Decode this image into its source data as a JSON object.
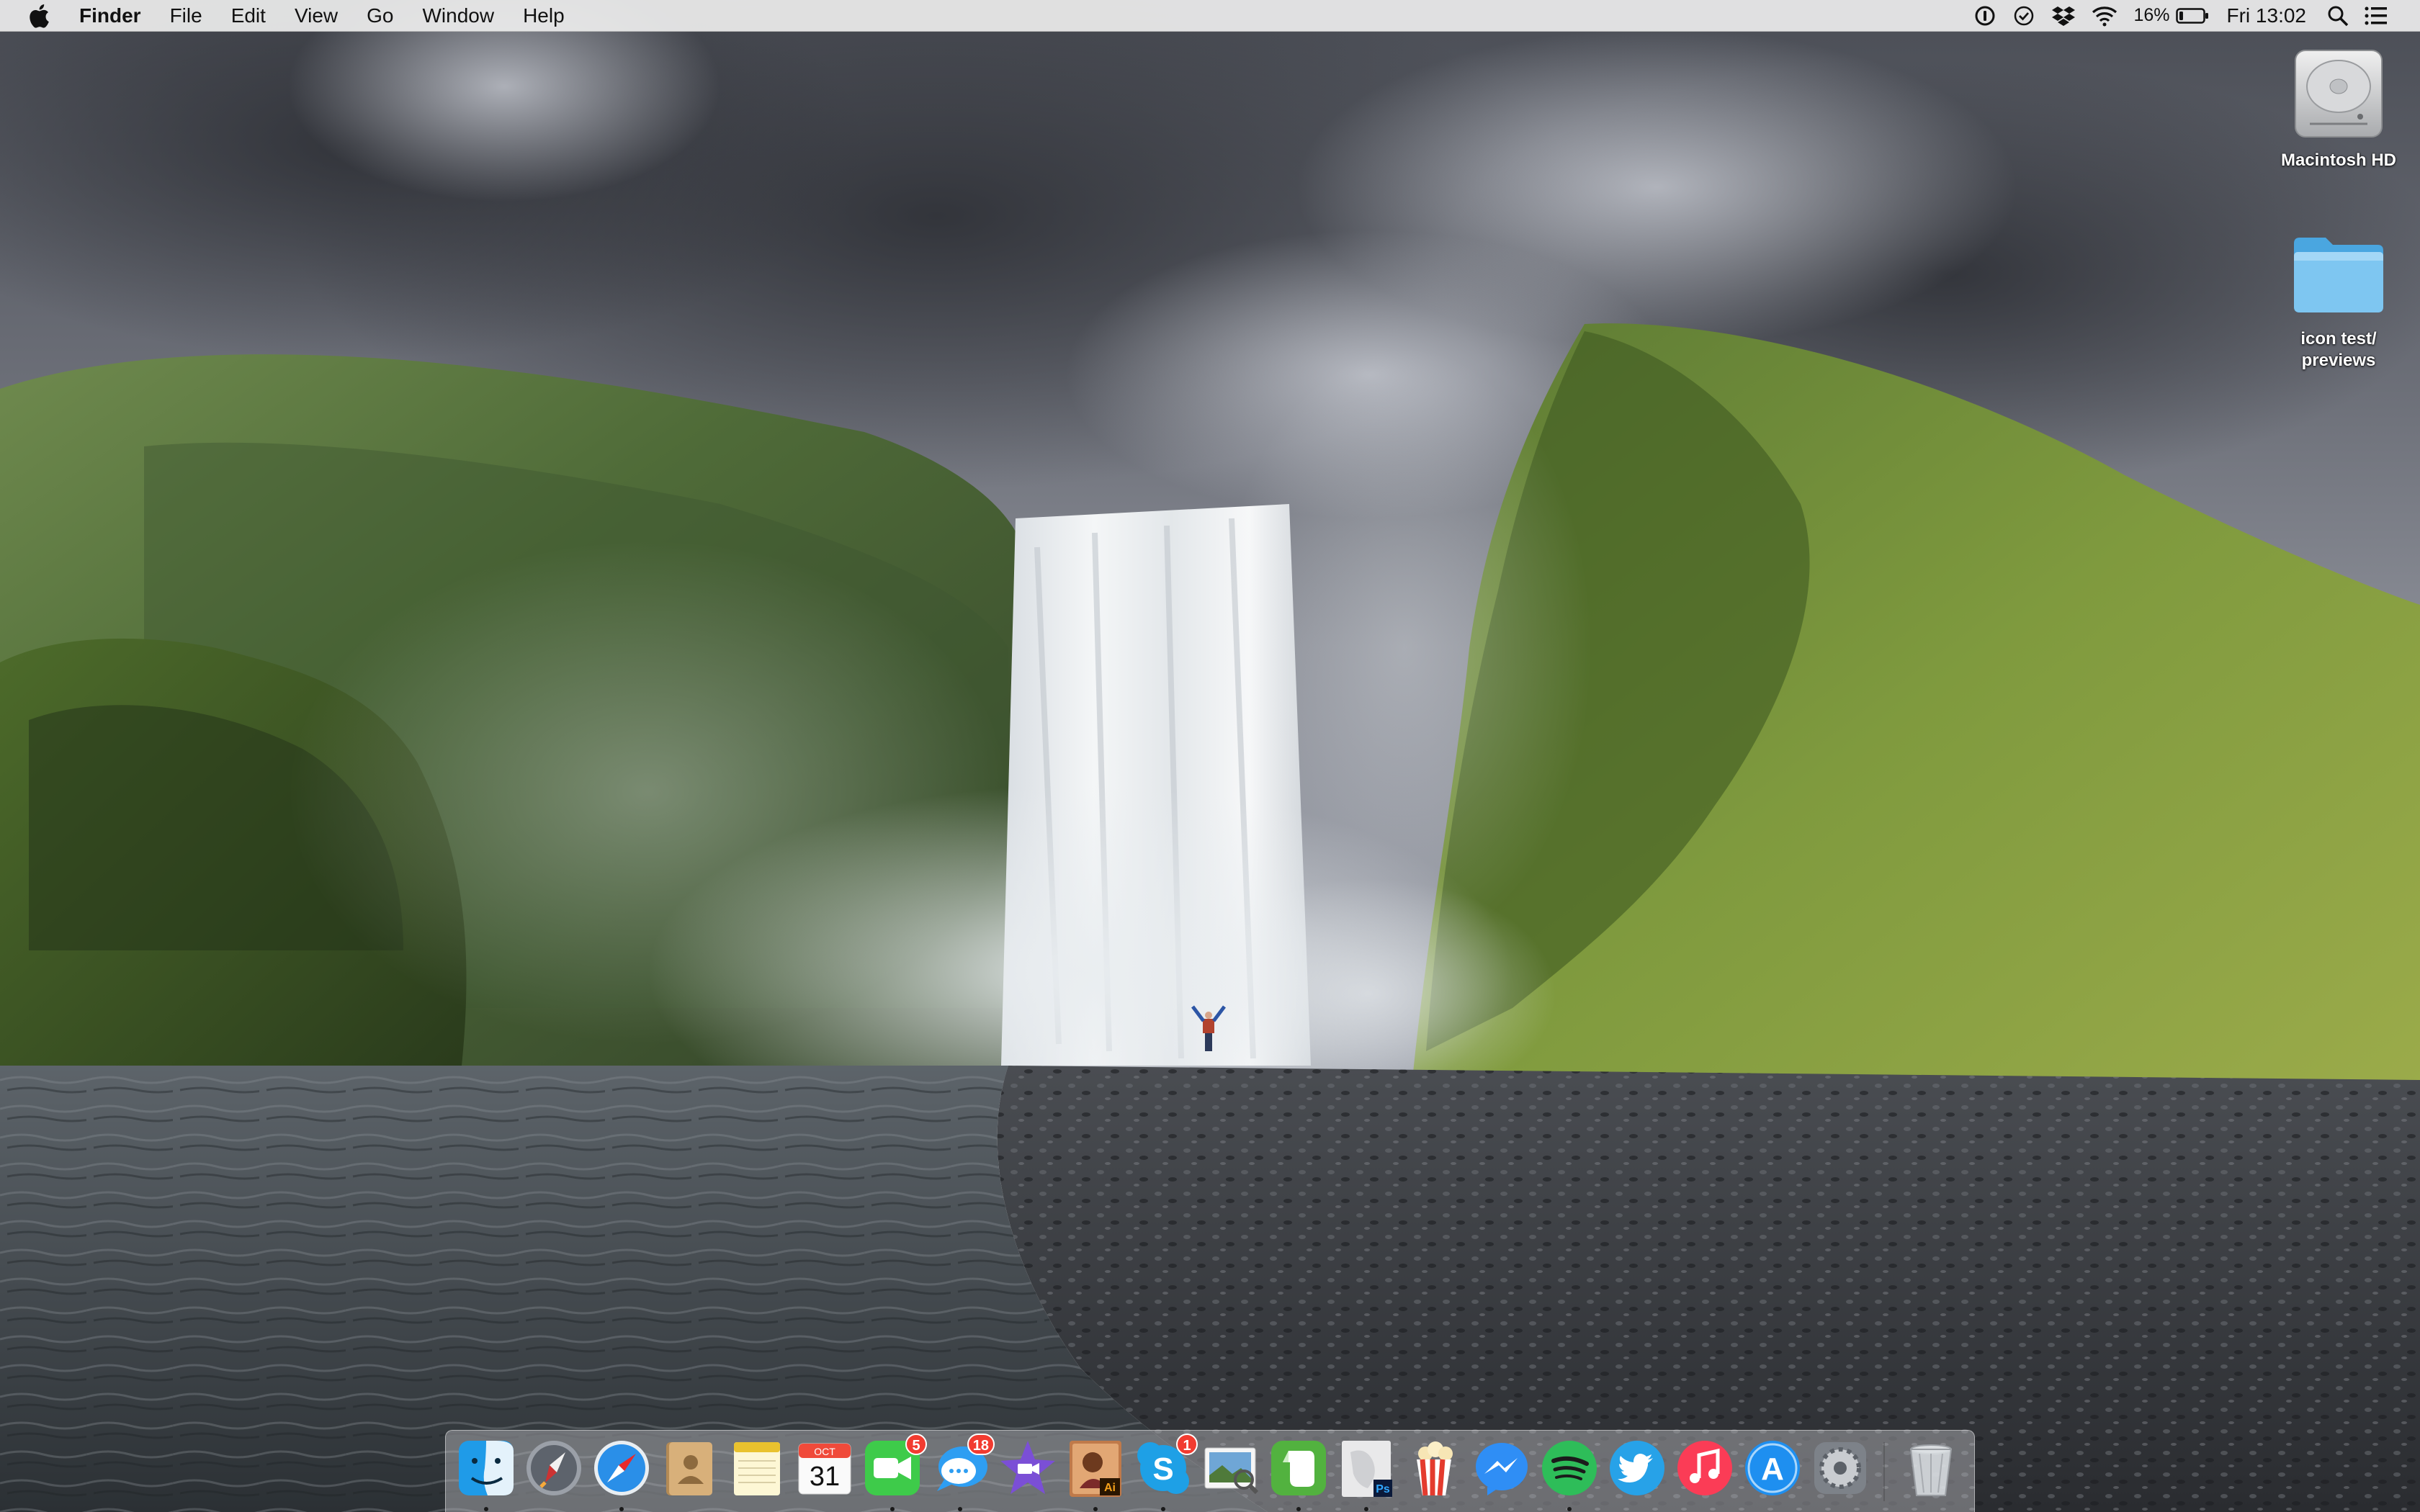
{
  "menubar": {
    "apple_icon": "apple-logo-icon",
    "app_name": "Finder",
    "menus": [
      "File",
      "Edit",
      "View",
      "Go",
      "Window",
      "Help"
    ],
    "status_icons": [
      "1password-icon",
      "checkmark-app-icon",
      "dropbox-icon",
      "wifi-icon"
    ],
    "battery_percent": "16%",
    "battery_level": 0.16,
    "clock": "Fri 13:02",
    "spotlight_icon": "spotlight-search-icon",
    "notification_icon": "notification-center-icon"
  },
  "desktop": {
    "icons": [
      {
        "label": "Macintosh HD",
        "icon": "hard-drive-icon"
      },
      {
        "label": "icon test/\npreviews",
        "icon": "folder-icon"
      }
    ]
  },
  "dock": {
    "items": [
      {
        "name": "finder",
        "running": true
      },
      {
        "name": "launchpad",
        "running": false
      },
      {
        "name": "safari",
        "running": true
      },
      {
        "name": "contacts",
        "running": false
      },
      {
        "name": "notes",
        "running": false
      },
      {
        "name": "calendar",
        "running": false,
        "month": "OCT",
        "day": "31"
      },
      {
        "name": "facetime",
        "running": true,
        "badge": "5"
      },
      {
        "name": "messages",
        "running": true,
        "badge": "18"
      },
      {
        "name": "imovie",
        "running": false
      },
      {
        "name": "illustrator",
        "running": true
      },
      {
        "name": "skype",
        "running": true,
        "badge": "1"
      },
      {
        "name": "preview",
        "running": false
      },
      {
        "name": "evernote",
        "running": true
      },
      {
        "name": "photoshop",
        "running": true
      },
      {
        "name": "popcorn-time",
        "running": false
      },
      {
        "name": "messenger",
        "running": false
      },
      {
        "name": "spotify",
        "running": true
      },
      {
        "name": "twitter",
        "running": false
      },
      {
        "name": "itunes",
        "running": false
      },
      {
        "name": "app-store",
        "running": false
      },
      {
        "name": "system-preferences",
        "running": false
      },
      {
        "name": "trash",
        "running": false
      }
    ],
    "app_store_glyph": "A",
    "skype_glyph": "S",
    "illustrator_glyph": "Ai",
    "photoshop_glyph": "Ps"
  }
}
